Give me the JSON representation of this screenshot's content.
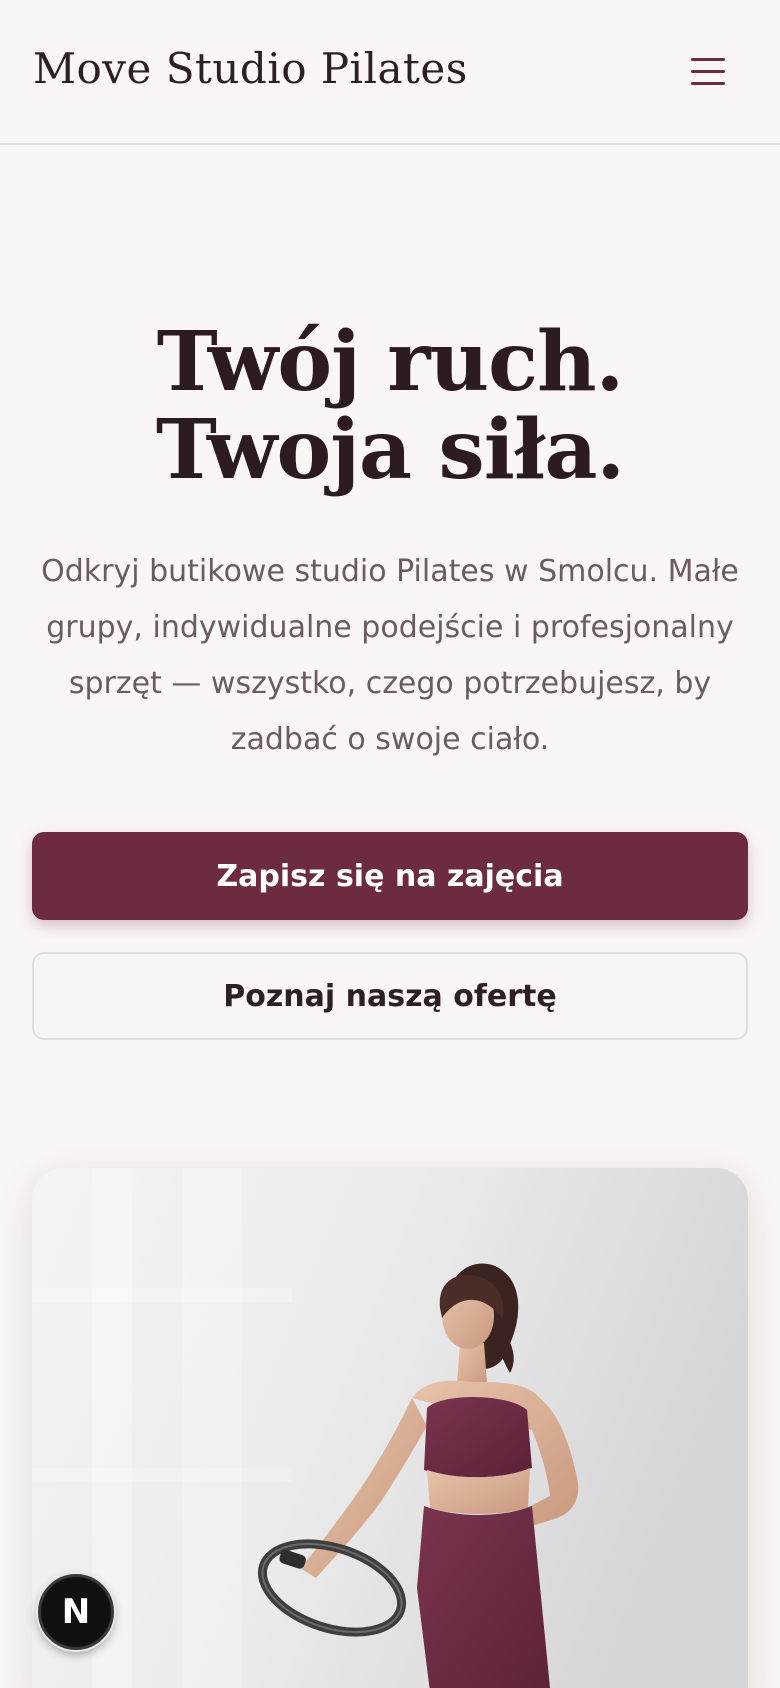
{
  "header": {
    "brand": "Move Studio Pilates",
    "menu_icon": "hamburger-menu-icon"
  },
  "hero": {
    "title": "Twój ruch. Twoja siła.",
    "subtitle": "Odkryj butikowe studio Pilates w Smolcu. Małe grupy, indywidualne podejście i profesjonalny sprzęt — wszystko, czego potrzebujesz, by zadbać o swoje ciało.",
    "primary_cta": "Zapisz się na zajęcia",
    "secondary_cta": "Poznaj naszą ofertę",
    "image_subject": "woman in pilates outfit holding a pilates ring"
  },
  "badge": {
    "label": "N",
    "icon": "nextjs-dev-indicator-icon"
  },
  "colors": {
    "accent": "#6d2c3e",
    "background": "#faf6f4",
    "text": "#2d1f22",
    "muted_text": "#6a5c5f"
  }
}
